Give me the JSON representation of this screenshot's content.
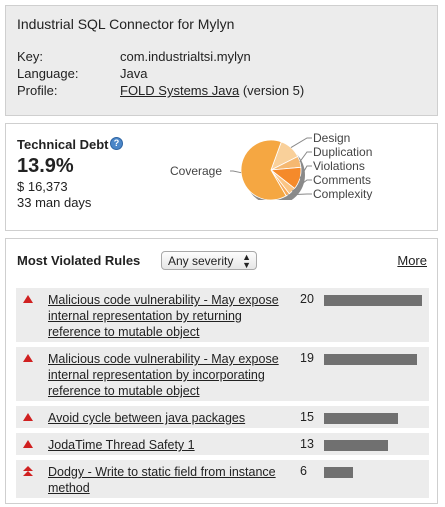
{
  "project": {
    "title": "Industrial SQL Connector for Mylyn",
    "key_label": "Key:",
    "key_value": "com.industrialtsi.mylyn",
    "language_label": "Language:",
    "language_value": "Java",
    "profile_label": "Profile:",
    "profile_link": "FOLD Systems Java",
    "profile_suffix": "(version 5)"
  },
  "debt": {
    "title": "Technical Debt",
    "help_icon": "?",
    "percent": "13.9%",
    "amount": "$ 16,373",
    "days": "33 man days",
    "chart_data": {
      "type": "pie",
      "categories": [
        "Design",
        "Duplication",
        "Violations",
        "Comments",
        "Complexity",
        "Coverage"
      ],
      "values": [
        12,
        6,
        12,
        4,
        2,
        64
      ],
      "colors": [
        "#f9d09a",
        "#f5b871",
        "#f58a2a",
        "#fbc585",
        "#f7a957",
        "#f5a742"
      ]
    }
  },
  "rules": {
    "title": "Most Violated Rules",
    "severity_select": "Any severity",
    "more_link": "More",
    "items": [
      {
        "name": "Malicious code vulnerability - May expose internal representation by returning reference to mutable object",
        "count": "20",
        "severity": "critical",
        "bar": 1.0
      },
      {
        "name": "Malicious code vulnerability - May expose internal representation by incorporating reference to mutable object",
        "count": "19",
        "severity": "critical",
        "bar": 0.95
      },
      {
        "name": "Avoid cycle between java packages",
        "count": "15",
        "severity": "critical",
        "bar": 0.75
      },
      {
        "name": "JodaTime Thread Safety 1",
        "count": "13",
        "severity": "critical",
        "bar": 0.65
      },
      {
        "name": "Dodgy - Write to static field from instance method",
        "count": "6",
        "severity": "blocker",
        "bar": 0.3
      }
    ]
  }
}
